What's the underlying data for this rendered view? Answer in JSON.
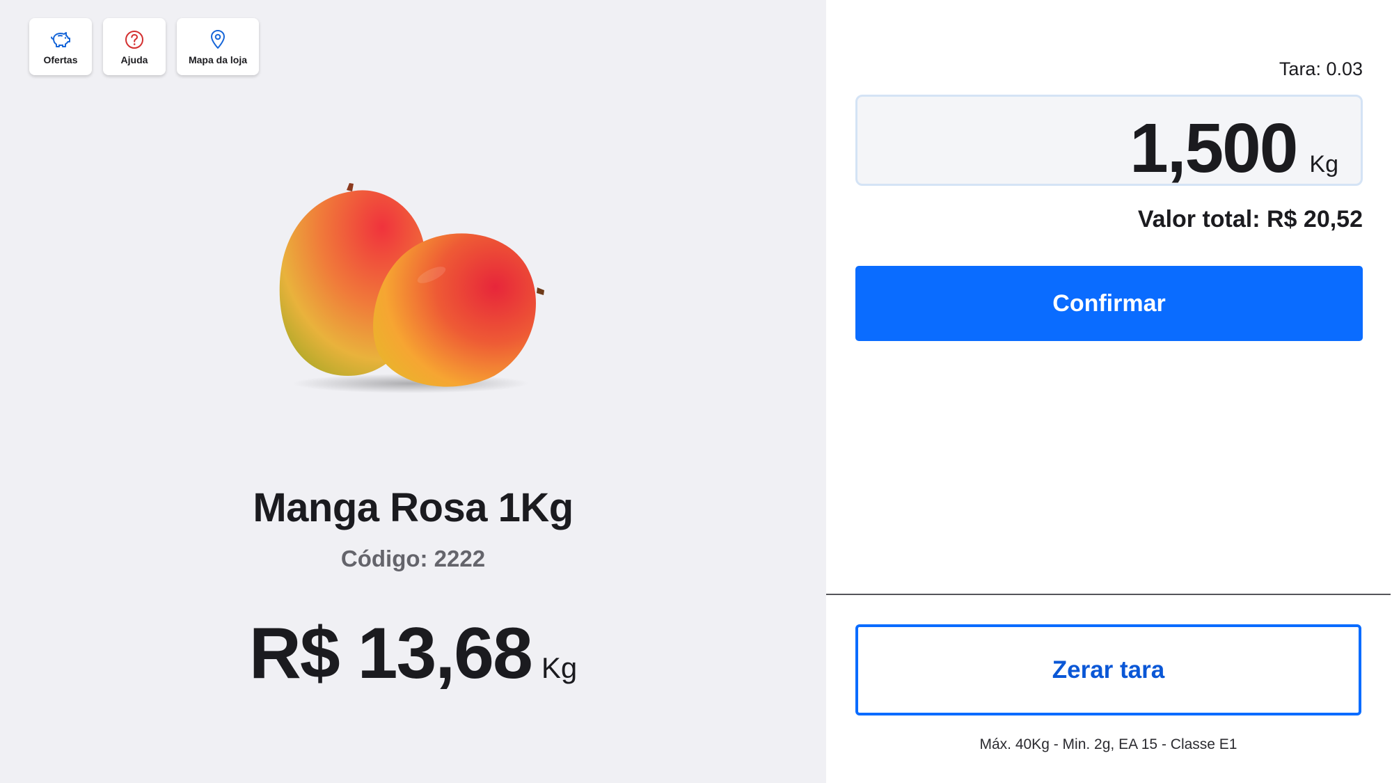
{
  "shortcuts": [
    {
      "label": "Ofertas",
      "icon": "piggy-bank-icon",
      "color": "#1565d8"
    },
    {
      "label": "Ajuda",
      "icon": "question-circle-icon",
      "color": "#d32f2f"
    },
    {
      "label": "Mapa da loja",
      "icon": "map-pin-icon",
      "color": "#1565d8"
    }
  ],
  "product": {
    "name": "Manga Rosa 1Kg",
    "code_text": "Código: 2222",
    "price": "R$ 13,68",
    "price_unit": "Kg",
    "image": "mango-image"
  },
  "scale": {
    "tara_text": "Tara: 0.03",
    "weight": "1,500",
    "weight_unit": "Kg",
    "total_text": "Valor total: R$ 20,52",
    "confirm_label": "Confirmar",
    "zero_tare_label": "Zerar tara",
    "spec_text": "Máx. 40Kg - Min. 2g, EA 15 - Classe E1"
  },
  "colors": {
    "accent": "#0a6cff",
    "left_bg": "#f0f0f4",
    "help_icon": "#d32f2f"
  }
}
